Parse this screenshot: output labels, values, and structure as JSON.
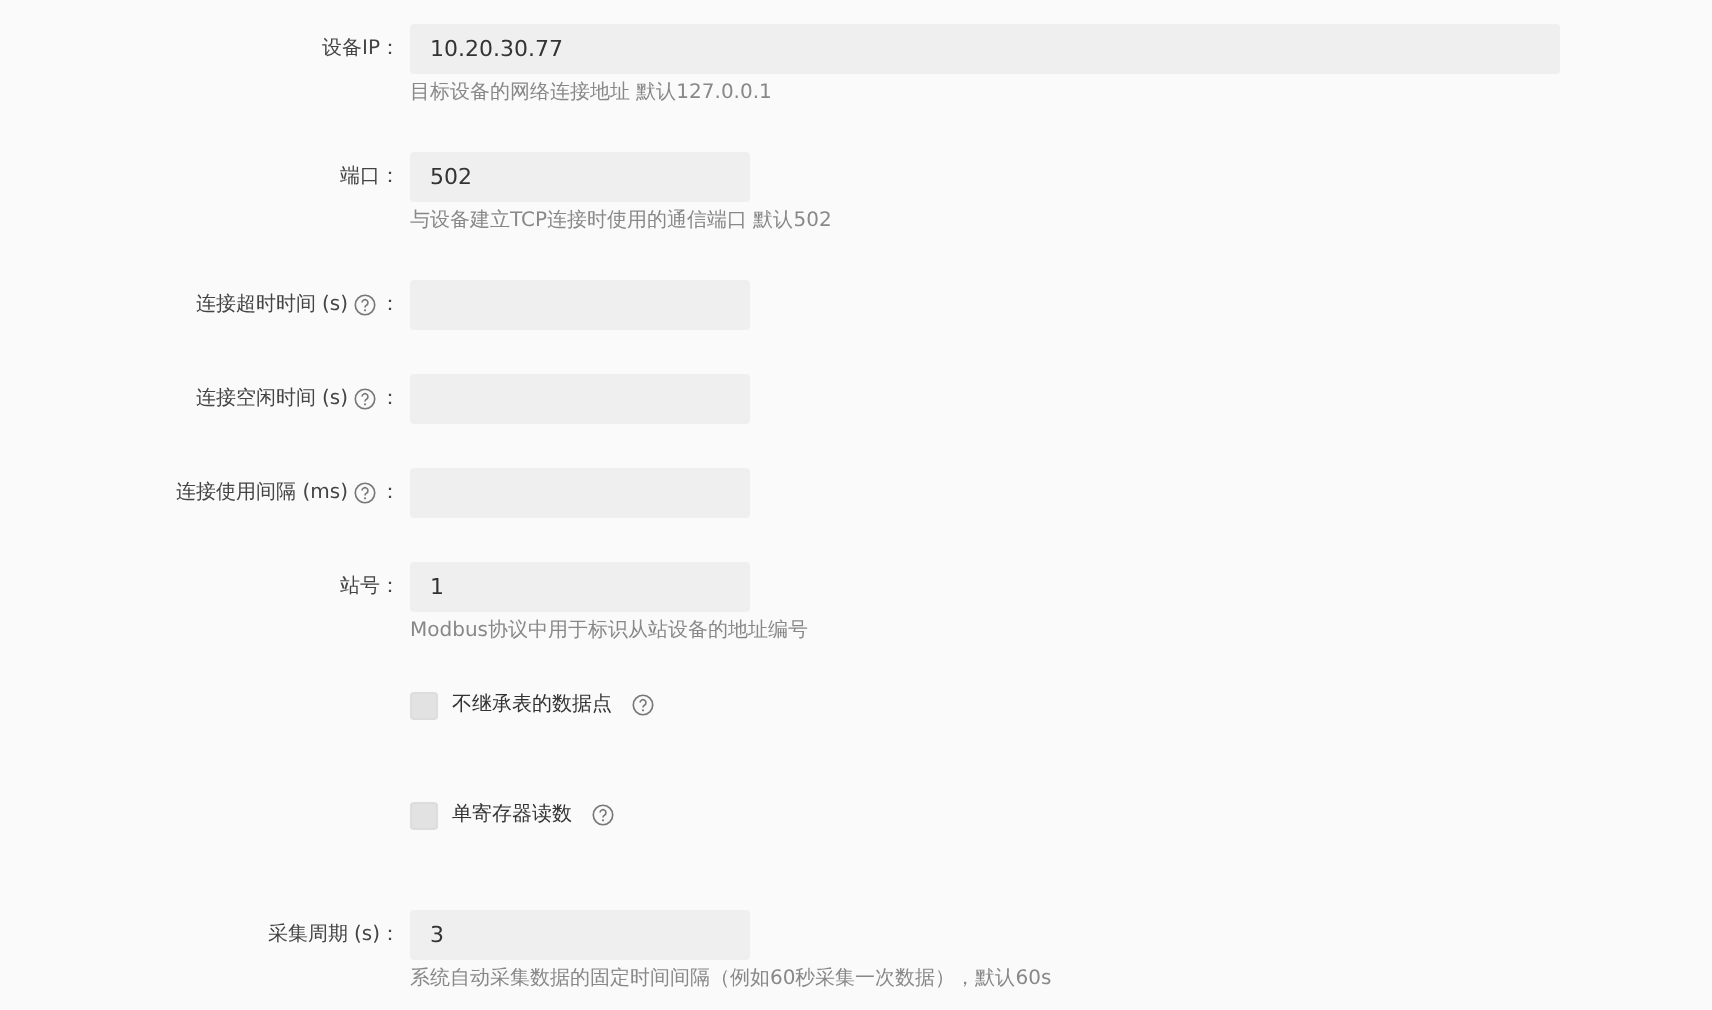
{
  "fields": [
    {
      "kind": "wide",
      "label": "设备IP",
      "help": false,
      "colon": "：",
      "value": "10.20.30.77",
      "hint": "目标设备的网络连接地址 默认127.0.0.1"
    },
    {
      "kind": "text",
      "label": "端口",
      "help": false,
      "colon": "：",
      "value": "502",
      "hint": "与设备建立TCP连接时使用的通信端口 默认502"
    },
    {
      "kind": "text",
      "label": "连接超时时间 (s)",
      "help": true,
      "colon": "："
    },
    {
      "kind": "text",
      "label": "连接空闲时间 (s)",
      "help": true,
      "colon": "："
    },
    {
      "kind": "text",
      "label": "连接使用间隔 (ms)",
      "help": true,
      "colon": "："
    },
    {
      "kind": "text",
      "label": "站号",
      "help": false,
      "colon": "：",
      "value": "1",
      "hint": "Modbus协议中用于标识从站设备的地址编号"
    },
    {
      "kind": "checkbox",
      "label": "不继承表的数据点",
      "help": true,
      "checked": false
    },
    {
      "kind": "checkbox",
      "label": "单寄存器读数",
      "help": true,
      "checked": false
    },
    {
      "kind": "text",
      "label": "采集周期 (s)",
      "help": false,
      "colon": "：",
      "value": "3",
      "hint": "系统自动采集数据的固定时间间隔（例如60秒采集一次数据），默认60s"
    }
  ]
}
